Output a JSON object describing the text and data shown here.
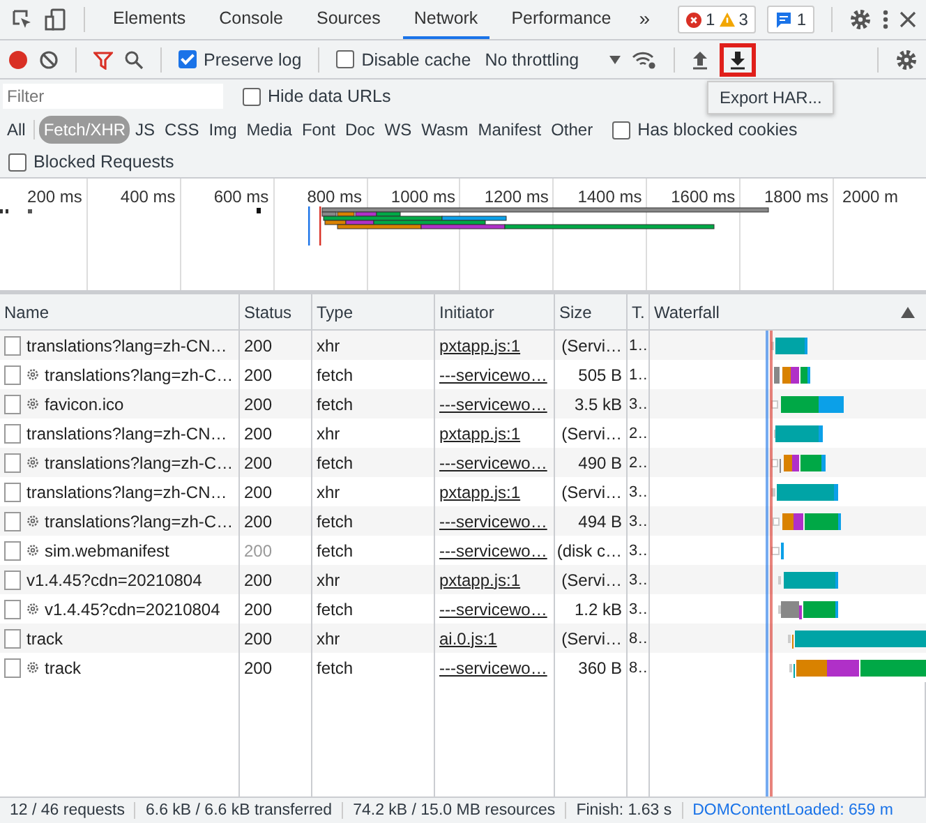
{
  "tabs": [
    {
      "label": "Elements",
      "selected": false
    },
    {
      "label": "Console",
      "selected": false
    },
    {
      "label": "Sources",
      "selected": false
    },
    {
      "label": "Network",
      "selected": true
    },
    {
      "label": "Performance",
      "selected": false
    }
  ],
  "more_tabs": "»",
  "badges": {
    "errors": "1",
    "warnings": "3",
    "messages": "1"
  },
  "toolbar": {
    "recording": true,
    "preserve_log": {
      "label": "Preserve log",
      "checked": true
    },
    "disable_cache": {
      "label": "Disable cache",
      "checked": false
    },
    "throttling": "No throttling",
    "export_highlighted": true,
    "tooltip": "Export HAR..."
  },
  "filter": {
    "placeholder": "Filter",
    "hide_data_urls": {
      "label": "Hide data URLs",
      "checked": false
    }
  },
  "types": [
    {
      "label": "All",
      "selected": false
    },
    {
      "label": "Fetch/XHR",
      "selected": true
    },
    {
      "label": "JS",
      "selected": false
    },
    {
      "label": "CSS",
      "selected": false
    },
    {
      "label": "Img",
      "selected": false
    },
    {
      "label": "Media",
      "selected": false
    },
    {
      "label": "Font",
      "selected": false
    },
    {
      "label": "Doc",
      "selected": false
    },
    {
      "label": "WS",
      "selected": false
    },
    {
      "label": "Wasm",
      "selected": false
    },
    {
      "label": "Manifest",
      "selected": false
    },
    {
      "label": "Other",
      "selected": false
    }
  ],
  "has_blocked_cookies": {
    "label": "Has blocked cookies",
    "checked": false
  },
  "blocked_requests": {
    "label": "Blocked Requests",
    "checked": false
  },
  "overview_ticks": [
    "200 ms",
    "400 ms",
    "600 ms",
    "800 ms",
    "1000 ms",
    "1200 ms",
    "1400 ms",
    "1600 ms",
    "1800 ms",
    "2000 m"
  ],
  "table": {
    "columns": [
      "Name",
      "Status",
      "Type",
      "Initiator",
      "Size",
      "T.",
      "Waterfall"
    ],
    "rows": [
      {
        "name": "translations?lang=zh-CN…",
        "service_worker": false,
        "status": "200",
        "dimmed": false,
        "type": "xhr",
        "initiator": "pxtapp.js:1",
        "size": "(Servi…",
        "time": "1…"
      },
      {
        "name": "translations?lang=zh-C…",
        "service_worker": true,
        "status": "200",
        "dimmed": false,
        "type": "fetch",
        "initiator": "---servicewo…",
        "size": "505 B",
        "time": "1…"
      },
      {
        "name": "favicon.ico",
        "service_worker": true,
        "status": "200",
        "dimmed": false,
        "type": "fetch",
        "initiator": "---servicewo…",
        "size": "3.5 kB",
        "time": "3…"
      },
      {
        "name": "translations?lang=zh-CN…",
        "service_worker": false,
        "status": "200",
        "dimmed": false,
        "type": "xhr",
        "initiator": "pxtapp.js:1",
        "size": "(Servi…",
        "time": "2…"
      },
      {
        "name": "translations?lang=zh-C…",
        "service_worker": true,
        "status": "200",
        "dimmed": false,
        "type": "fetch",
        "initiator": "---servicewo…",
        "size": "490 B",
        "time": "2…"
      },
      {
        "name": "translations?lang=zh-CN…",
        "service_worker": false,
        "status": "200",
        "dimmed": false,
        "type": "xhr",
        "initiator": "pxtapp.js:1",
        "size": "(Servi…",
        "time": "3…"
      },
      {
        "name": "translations?lang=zh-C…",
        "service_worker": true,
        "status": "200",
        "dimmed": false,
        "type": "fetch",
        "initiator": "---servicewo…",
        "size": "494 B",
        "time": "3…"
      },
      {
        "name": "sim.webmanifest",
        "service_worker": true,
        "status": "200",
        "dimmed": true,
        "type": "fetch",
        "initiator": "---servicewo…",
        "size": "(disk c…",
        "time": "3…"
      },
      {
        "name": "v1.4.45?cdn=20210804",
        "service_worker": false,
        "status": "200",
        "dimmed": false,
        "type": "xhr",
        "initiator": "pxtapp.js:1",
        "size": "(Servi…",
        "time": "3…"
      },
      {
        "name": "v1.4.45?cdn=20210804",
        "service_worker": true,
        "status": "200",
        "dimmed": false,
        "type": "fetch",
        "initiator": "---servicewo…",
        "size": "1.2 kB",
        "time": "3…"
      },
      {
        "name": "track",
        "service_worker": false,
        "status": "200",
        "dimmed": false,
        "type": "xhr",
        "initiator": "ai.0.js:1",
        "size": "(Servi…",
        "time": "8…"
      },
      {
        "name": "track",
        "service_worker": true,
        "status": "200",
        "dimmed": false,
        "type": "fetch",
        "initiator": "---servicewo…",
        "size": "360 B",
        "time": "8…"
      }
    ]
  },
  "status_bar": [
    "12 / 46 requests",
    "6.6 kB / 6.6 kB transferred",
    "74.2 kB / 15.0 MB resources",
    "Finish: 1.63 s",
    "DOMContentLoaded: 659 m"
  ]
}
